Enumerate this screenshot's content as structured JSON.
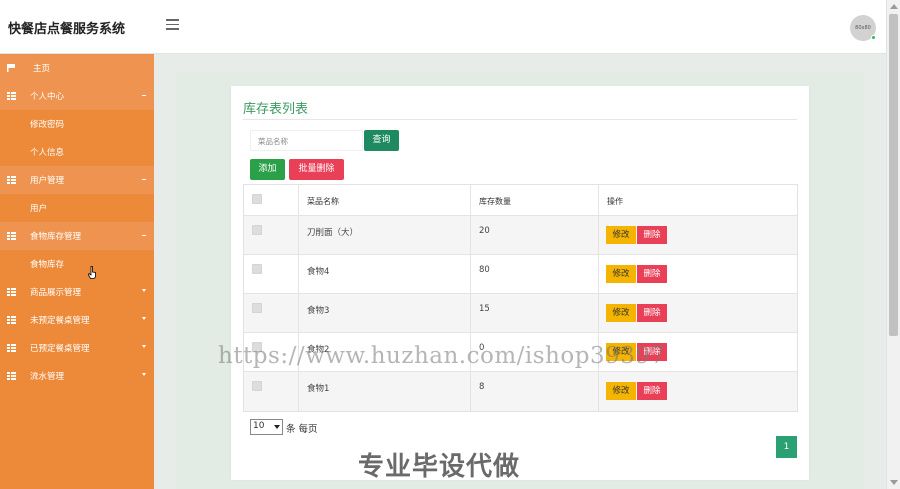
{
  "header": {
    "brand": "快餐店点餐服务系统",
    "avatar_text": "80x80"
  },
  "sidebar": {
    "items": [
      {
        "label": "主页",
        "icon": "flag-icon",
        "type": "top"
      },
      {
        "label": "个人中心",
        "icon": "grid-icon",
        "type": "top",
        "expanded": true
      },
      {
        "label": "修改密码",
        "type": "sub"
      },
      {
        "label": "个人信息",
        "type": "sub"
      },
      {
        "label": "用户管理",
        "icon": "grid-icon",
        "type": "top",
        "expanded": true
      },
      {
        "label": "用户",
        "type": "sub"
      },
      {
        "label": "食物库存管理",
        "icon": "grid-icon",
        "type": "top",
        "expanded": true
      },
      {
        "label": "食物库存",
        "type": "sub",
        "active": true
      },
      {
        "label": "商品展示管理",
        "icon": "grid-icon",
        "type": "top"
      },
      {
        "label": "未预定餐桌管理",
        "icon": "grid-icon",
        "type": "top"
      },
      {
        "label": "已预定餐桌管理",
        "icon": "grid-icon",
        "type": "top"
      },
      {
        "label": "流水管理",
        "icon": "grid-icon",
        "type": "top"
      }
    ]
  },
  "main": {
    "title": "库存表列表",
    "search": {
      "placeholder": "菜品名称",
      "button": "查询"
    },
    "add_button": "添加",
    "batch_delete_button": "批量删除",
    "table": {
      "columns": [
        "菜品名称",
        "库存数量",
        "操作"
      ],
      "rows": [
        {
          "name": "刀削面（大）",
          "qty": "20"
        },
        {
          "name": "食物4",
          "qty": "80"
        },
        {
          "name": "食物3",
          "qty": "15"
        },
        {
          "name": "食物2",
          "qty": "0"
        },
        {
          "name": "食物1",
          "qty": "8"
        }
      ],
      "edit_label": "修改",
      "delete_label": "删除"
    },
    "pagination": {
      "page_size": "10",
      "per_page_suffix": "条 每页",
      "current_page": "1"
    }
  },
  "overlay": {
    "watermark": "https://www.huzhan.com/ishop39397",
    "promo": "专业毕设代做"
  },
  "colors": {
    "sidebar": "#ed8a3a",
    "accent_green": "#1f8a62",
    "add_green": "#2aa048",
    "danger": "#e94058",
    "warning": "#f4b400",
    "title_green": "#3b9a62"
  }
}
